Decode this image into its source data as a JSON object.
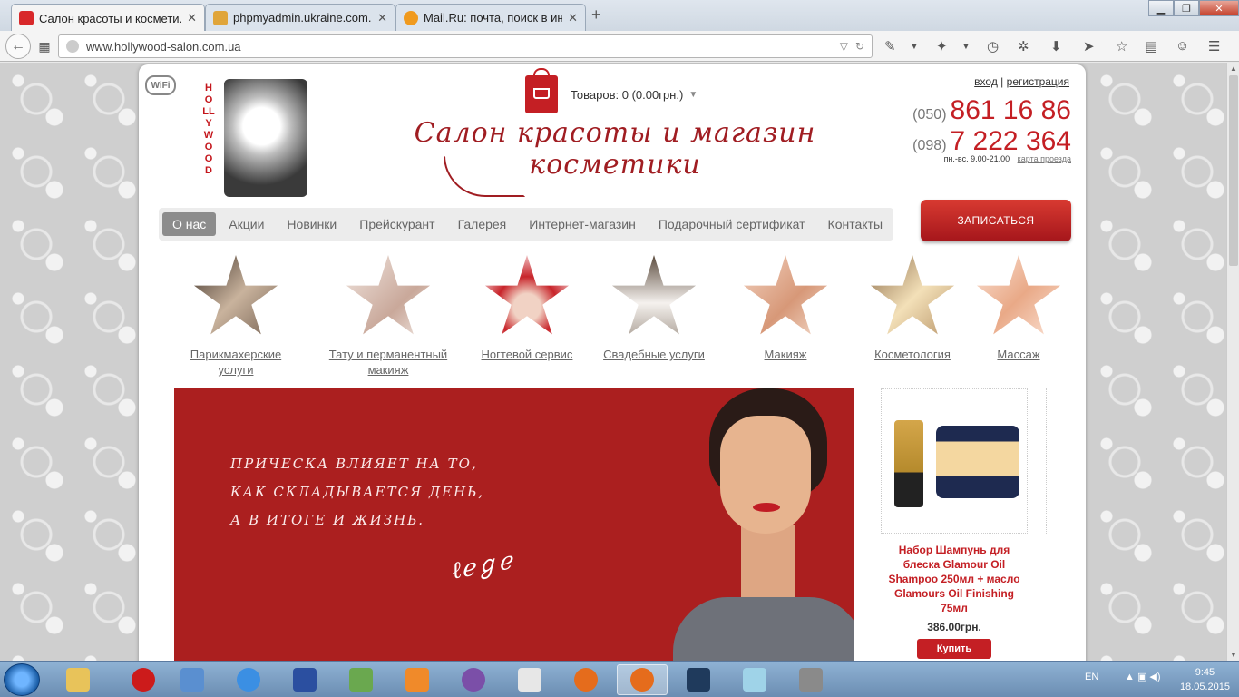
{
  "browser": {
    "tabs": [
      {
        "label": "Салон красоты и космети...",
        "favicon_color": "#d8282a",
        "active": true
      },
      {
        "label": "phpmyadmin.ukraine.com...",
        "favicon_color": "#e0a53a",
        "active": false
      },
      {
        "label": "Mail.Ru: почта, поиск в ин...",
        "favicon_color": "#f09a1e",
        "active": false
      }
    ],
    "new_tab": "+",
    "url": "www.hollywood-salon.com.ua"
  },
  "header": {
    "wifi_label": "WiFi",
    "logo_text": "HOLLYWOOD",
    "cart_label": "Товаров: 0 (0.00грн.)",
    "slogan": "Салон красоты и магазин косметики",
    "login": "вход",
    "separator": "|",
    "register": "регистрация",
    "phones": [
      {
        "code": "(050)",
        "number": "861 16 86"
      },
      {
        "code": "(098)",
        "number": "7 222 364"
      }
    ],
    "hours": "пн.-вс. 9.00-21.00",
    "map_link": "карта проезда",
    "book_button": "ЗАПИСАТЬСЯ"
  },
  "menu": {
    "items": [
      "О нас",
      "Акции",
      "Новинки",
      "Прейскурант",
      "Галерея",
      "Интернет-магазин",
      "Подарочный сертификат",
      "Контакты"
    ],
    "active": "О нас"
  },
  "services": [
    {
      "label": "Парикмахерские услуги",
      "color": "#8f7a6a"
    },
    {
      "label": "Тату и перманентный макияж",
      "color": "#d6bfb4"
    },
    {
      "label": "Ногтевой сервис",
      "color": "#c8242a"
    },
    {
      "label": "Свадебные услуги",
      "color": "#b8ada5"
    },
    {
      "label": "Макияж",
      "color": "#e4b59c"
    },
    {
      "label": "Косметология",
      "color": "#c9a77a"
    },
    {
      "label": "Массаж",
      "color": "#f0c3a8"
    }
  ],
  "banner": {
    "quote_lines": [
      "ПРИЧЕСКА ВЛИЯЕТ НА ТО,",
      "КАК СКЛАДЫВАЕТСЯ ДЕНЬ,",
      "А В ИТОГЕ И ЖИЗНЬ."
    ],
    "bg_color": "#ab1f1f"
  },
  "product": {
    "name": "Набор Шампунь для блеска Glamour Oil Shampoo 250мл + масло Glamours Oil Finishing 75мл",
    "price": "386.00грн.",
    "buy_label": "Купить"
  },
  "taskbar": {
    "lang": "EN",
    "time": "9:45",
    "date": "18.05.2015",
    "apps": [
      {
        "name": "explorer",
        "color": "#e8c35a"
      },
      {
        "name": "opera",
        "color": "#cc1b1b"
      },
      {
        "name": "volume",
        "color": "#5a8fd0"
      },
      {
        "name": "internet-explorer",
        "color": "#3b8fe3"
      },
      {
        "name": "save",
        "color": "#2b4fa0"
      },
      {
        "name": "notepad",
        "color": "#6aa84f"
      },
      {
        "name": "media-player",
        "color": "#f08a2a"
      },
      {
        "name": "viber",
        "color": "#7b4fa8"
      },
      {
        "name": "document",
        "color": "#e7e7e7"
      },
      {
        "name": "firefox",
        "color": "#e56c1c"
      },
      {
        "name": "firefox-active",
        "color": "#e56c1c"
      },
      {
        "name": "photoshop",
        "color": "#1f3a5c"
      },
      {
        "name": "glass",
        "color": "#9fd3e8"
      },
      {
        "name": "tools",
        "color": "#8a8a8a"
      }
    ]
  }
}
